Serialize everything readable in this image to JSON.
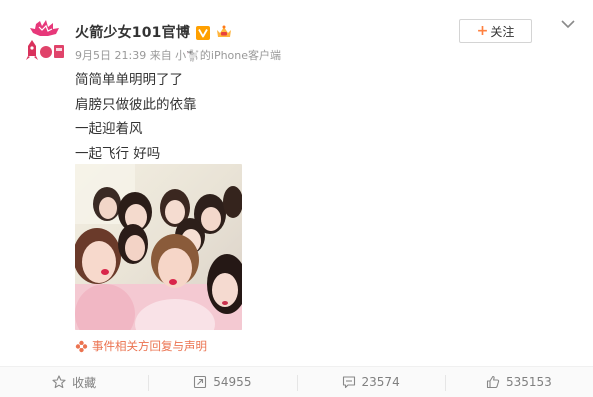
{
  "post": {
    "username": "火箭少女101官博",
    "badges": {
      "verified": "v-badge-icon",
      "member": "member-crown-icon"
    },
    "meta": "9月5日 21:39 来自 小🐩的iPhone客户端",
    "follow_label": "关注",
    "content_lines": [
      "简简单单明明了了",
      "肩膀只做彼此的依靠",
      "一起迎着风",
      "一起飞行 好吗"
    ],
    "notice": "事件相关方回复与声明",
    "photo_alt": "group-selfie-photo"
  },
  "actions": {
    "favorite_label": "收藏",
    "repost_count": "54955",
    "comment_count": "23574",
    "like_count": "535153"
  },
  "colors": {
    "accent": "#ff8140",
    "notice": "#eb7350",
    "verified": "#ffa000",
    "meta": "#999999"
  }
}
